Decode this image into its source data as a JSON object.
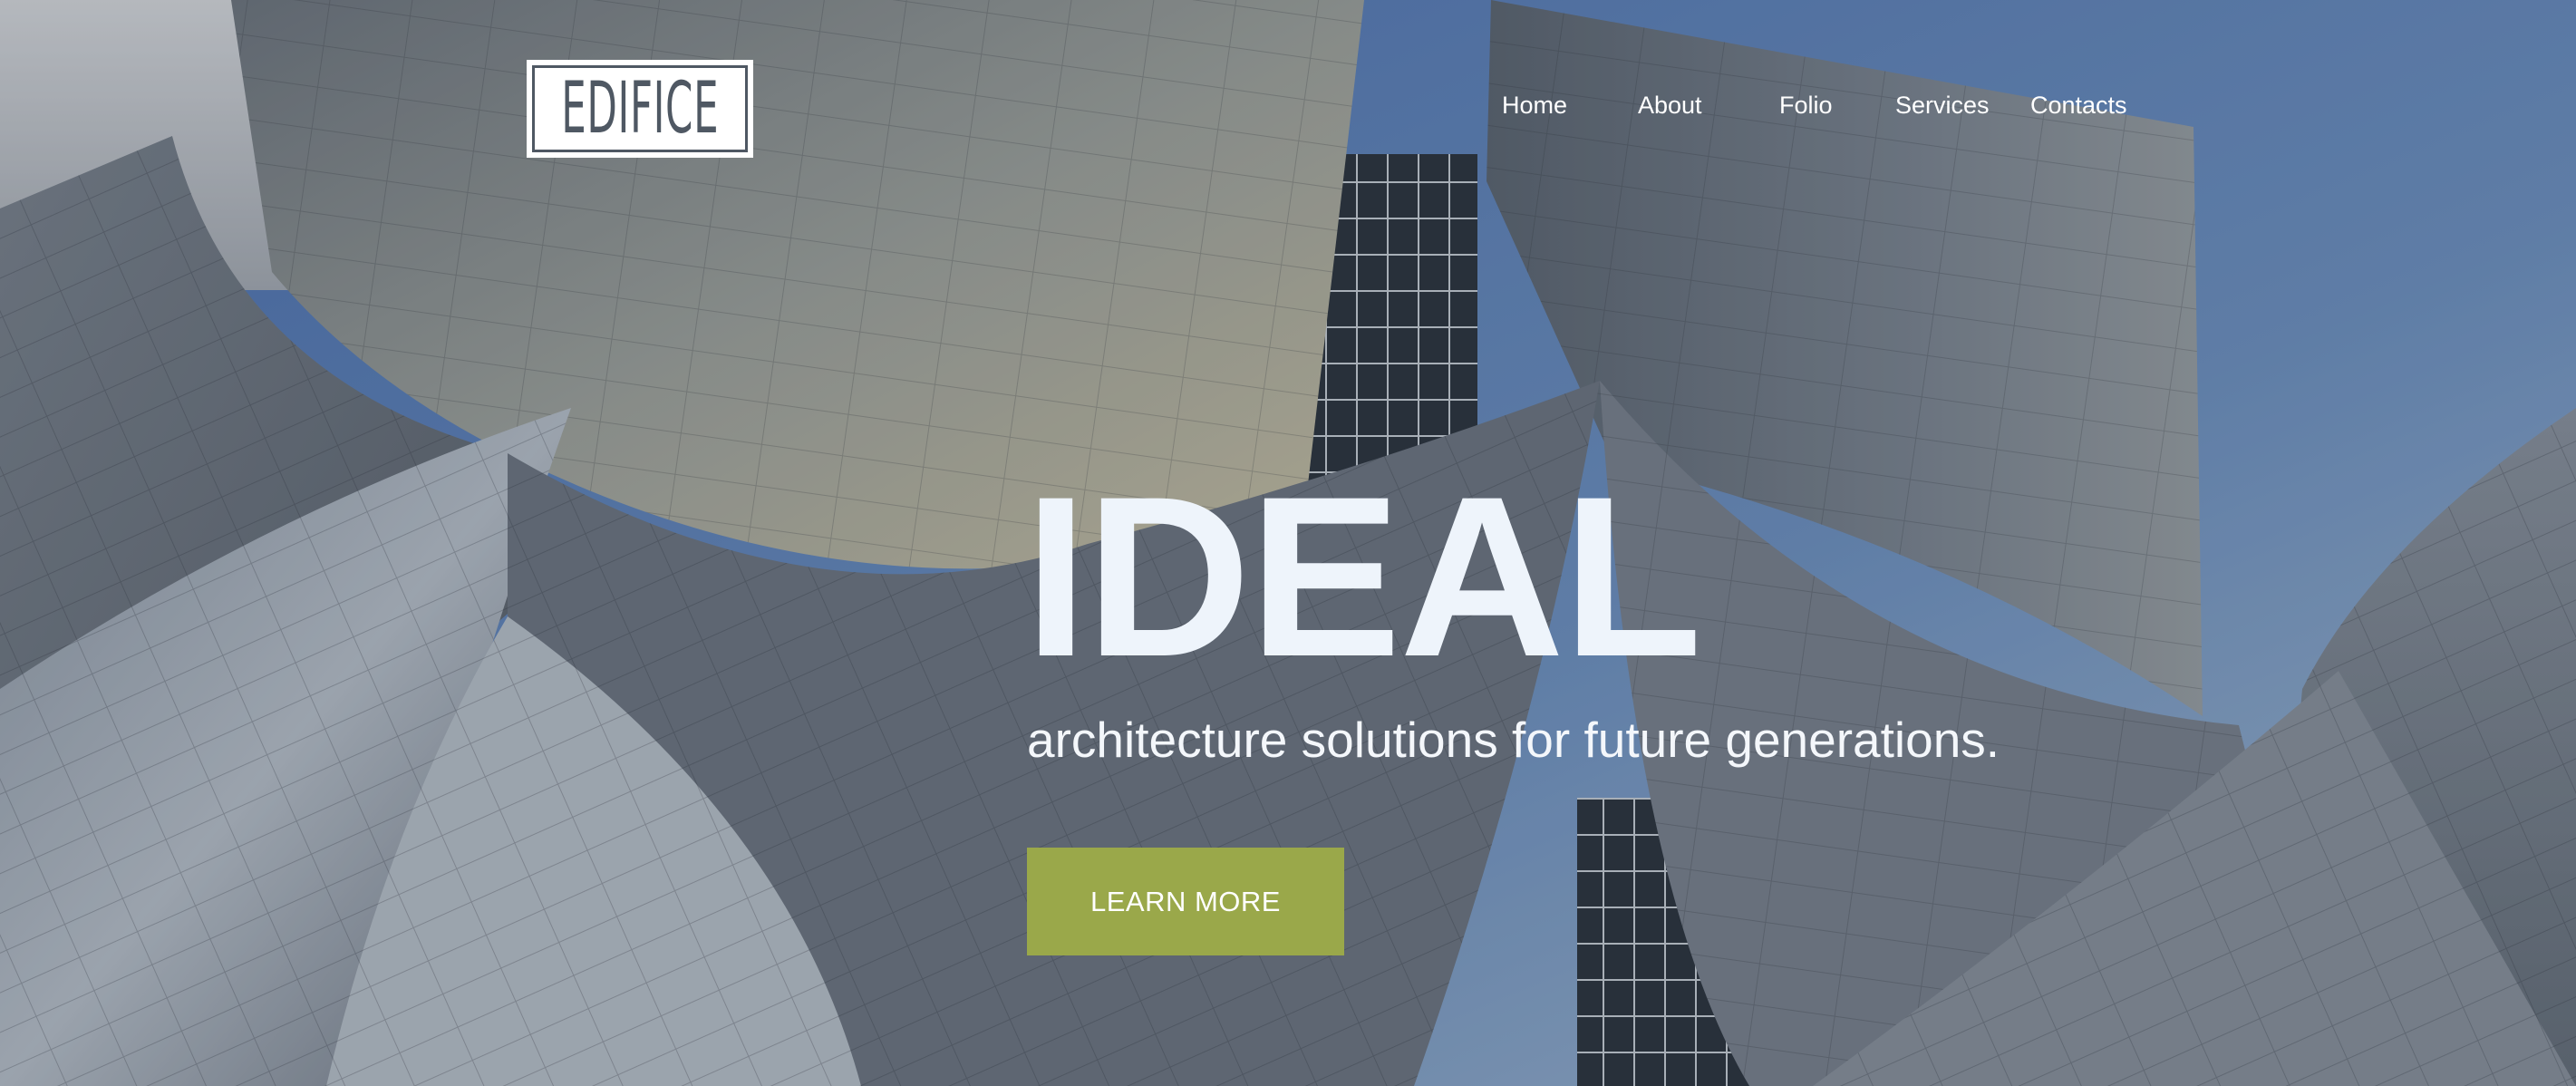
{
  "brand": {
    "logo_text": "EDIFICE"
  },
  "nav": {
    "items": [
      {
        "label": "Home"
      },
      {
        "label": "About"
      },
      {
        "label": "Folio"
      },
      {
        "label": "Services"
      },
      {
        "label": "Contacts"
      }
    ]
  },
  "hero": {
    "title": "IDEAL",
    "subtitle": "architecture solutions for future generations.",
    "cta_label": "LEARN MORE"
  },
  "colors": {
    "cta_background": "#9aa84a",
    "text": "#ffffff",
    "logo_ink": "#4f5863"
  },
  "background": {
    "description_icon": "architecture-photo"
  }
}
